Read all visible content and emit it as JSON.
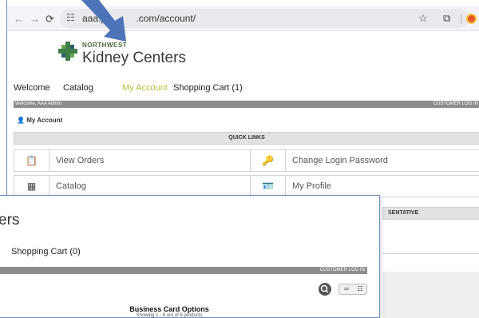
{
  "browser": {
    "url": "aaa.pr          .com/account/",
    "back_icon": "←",
    "forward_icon": "→",
    "reload_icon": "⟳",
    "site_info_icon": "☷",
    "bookmark_icon": "☆",
    "extensions_icon": "⧉",
    "menu_icon": "|"
  },
  "brand": {
    "top": "NORTHWEST",
    "main": "Kidney Centers"
  },
  "back_menu": {
    "welcome": "Welcome",
    "catalog": "Catalog",
    "my_account": "My Account",
    "cart": "Shopping Cart (1)"
  },
  "back_bar": {
    "left": "Welcome, AAA Admin",
    "right": "CUSTOMER LOG IN"
  },
  "account": {
    "heading": "My Account",
    "icon": "👤"
  },
  "quick_links": {
    "title": "QUICK LINKS",
    "items": [
      {
        "label": "View Orders",
        "icon": "📋"
      },
      {
        "label": "Change Login Password",
        "icon": "🔑"
      },
      {
        "label": "Catalog",
        "icon": "▦"
      },
      {
        "label": "My Profile",
        "icon": "🪪"
      }
    ]
  },
  "representative": {
    "title": "SENTATIVE"
  },
  "front": {
    "title": "ers",
    "cart": "Shopping Cart (0)",
    "bar_right": "CUSTOMER LOG IN",
    "search_icon": "⚲",
    "list_icon": "═",
    "grid_icon": "☷",
    "options_title": "Business Card Options",
    "options_sub": "Showing 1 - 6 out of 6 products"
  },
  "colors": {
    "accent_lime": "#b8c33a",
    "bar_gray": "#8d8d8d",
    "brand_green": "#3e7d46",
    "arrow_blue": "#4d73b8"
  }
}
